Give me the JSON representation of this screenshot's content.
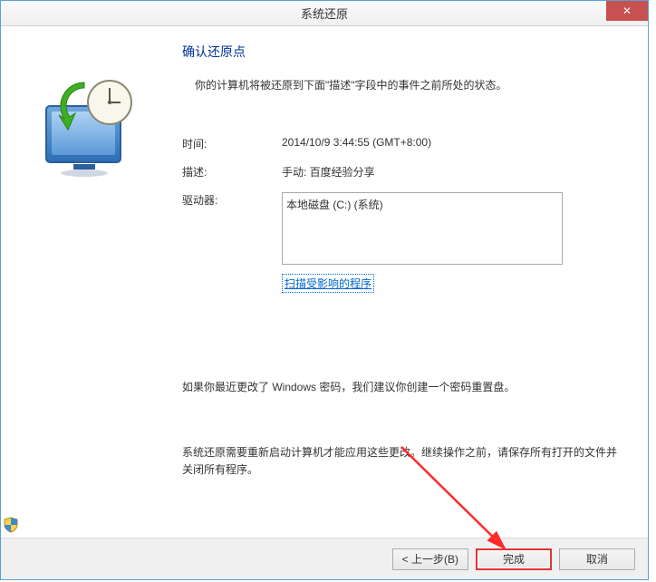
{
  "titlebar": {
    "title": "系统还原",
    "close": "✕"
  },
  "content": {
    "heading": "确认还原点",
    "intro": "你的计算机将被还原到下面\"描述\"字段中的事件之前所处的状态。",
    "labels": {
      "time": "时间:",
      "description": "描述:",
      "drive": "驱动器:"
    },
    "values": {
      "time": "2014/10/9 3:44:55 (GMT+8:00)",
      "description": "手动: 百度经验分享",
      "drive": "本地磁盘 (C:) (系统)"
    },
    "scan_link": "扫描受影响的程序",
    "password_note": "如果你最近更改了 Windows 密码，我们建议你创建一个密码重置盘。",
    "restart_note": "系统还原需要重新启动计算机才能应用这些更改。继续操作之前，请保存所有打开的文件并关闭所有程序。"
  },
  "footer": {
    "back": "< 上一步(B)",
    "finish": "完成",
    "cancel": "取消"
  }
}
